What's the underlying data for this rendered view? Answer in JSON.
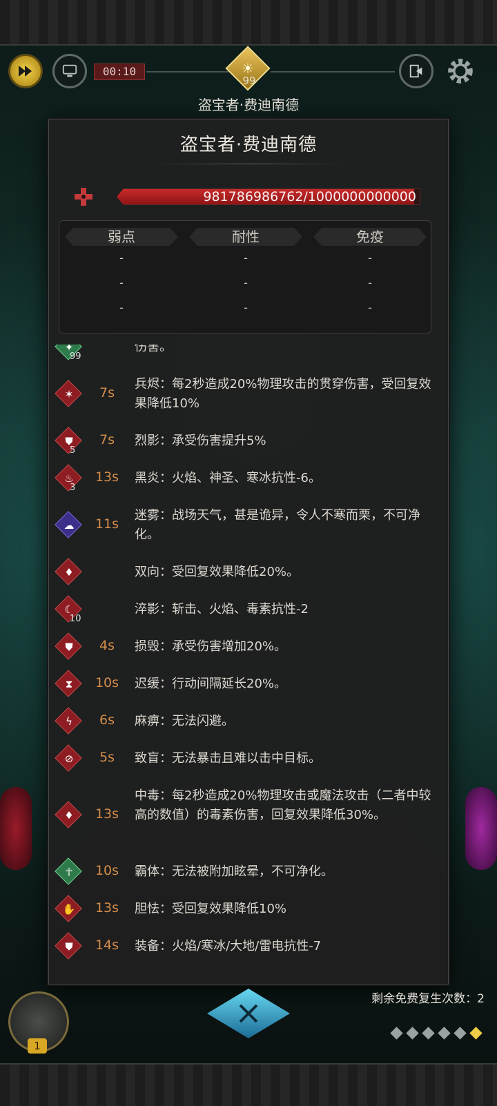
{
  "hud": {
    "timer": "00:10",
    "boss_level": "99",
    "boss_name": "盗宝者·费迪南德"
  },
  "panel": {
    "title": "盗宝者·费迪南德",
    "hp_text": "981786986762/1000000000000",
    "hp_fraction": 0.9818,
    "resist_headers": [
      "弱点",
      "耐性",
      "免疫"
    ],
    "resist_rows": [
      [
        "-",
        "-",
        "-"
      ],
      [
        "-",
        "-",
        "-"
      ],
      [
        "-",
        "-",
        "-"
      ]
    ]
  },
  "buffs": [
    {
      "icon": "buff-icon",
      "color": "green",
      "stack": "99",
      "time": "",
      "desc": "伤害。"
    },
    {
      "icon": "weapon-burn-icon",
      "color": "red",
      "stack": "",
      "time": "7s",
      "desc": "兵烬：每2秒造成20%物理攻击的贯穿伤害，受回复效果降低10%"
    },
    {
      "icon": "shield-icon",
      "color": "red",
      "stack": "5",
      "time": "7s",
      "desc": "烈影：承受伤害提升5%"
    },
    {
      "icon": "black-flame-icon",
      "color": "red",
      "stack": "3",
      "time": "13s",
      "desc": "黑炎：火焰、神圣、寒冰抗性-6。"
    },
    {
      "icon": "fog-icon",
      "color": "purple",
      "stack": "",
      "time": "11s",
      "desc": "迷雾：战场天气，甚是诡异，令人不寒而栗，不可净化。"
    },
    {
      "icon": "drops-icon",
      "color": "red",
      "stack": "",
      "time": "",
      "desc": "双向：受回复效果降低20%。"
    },
    {
      "icon": "crescent-icon",
      "color": "red",
      "stack": "10",
      "time": "",
      "desc": "淬影：斩击、火焰、毒素抗性-2"
    },
    {
      "icon": "shield-icon",
      "color": "red",
      "stack": "",
      "time": "4s",
      "desc": "损毁：承受伤害增加20%。"
    },
    {
      "icon": "hourglass-icon",
      "color": "red",
      "stack": "",
      "time": "10s",
      "desc": "迟缓：行动间隔延长20%。"
    },
    {
      "icon": "paralyze-icon",
      "color": "red",
      "stack": "",
      "time": "6s",
      "desc": "麻痹：无法闪避。"
    },
    {
      "icon": "blind-icon",
      "color": "red",
      "stack": "",
      "time": "5s",
      "desc": "致盲：无法暴击且难以击中目标。"
    },
    {
      "icon": "poison-icon",
      "color": "red",
      "stack": "",
      "time": "13s",
      "desc": "中毒：每2秒造成20%物理攻击或魔法攻击（二者中较高的数值）的毒素伤害，回复效果降低30%。"
    },
    {
      "icon": "stance-icon",
      "color": "green",
      "stack": "",
      "time": "10s",
      "desc": "霸体：无法被附加眩晕，不可净化。"
    },
    {
      "icon": "fear-icon",
      "color": "red",
      "stack": "",
      "time": "13s",
      "desc": "胆怯：受回复效果降低10%"
    },
    {
      "icon": "shield-icon",
      "color": "red",
      "stack": "",
      "time": "14s",
      "desc": "装备：火焰/寒冰/大地/雷电抗性-7"
    }
  ],
  "bottom": {
    "revive_text": "剩余免费复生次数：2",
    "portrait_badge": "1"
  }
}
